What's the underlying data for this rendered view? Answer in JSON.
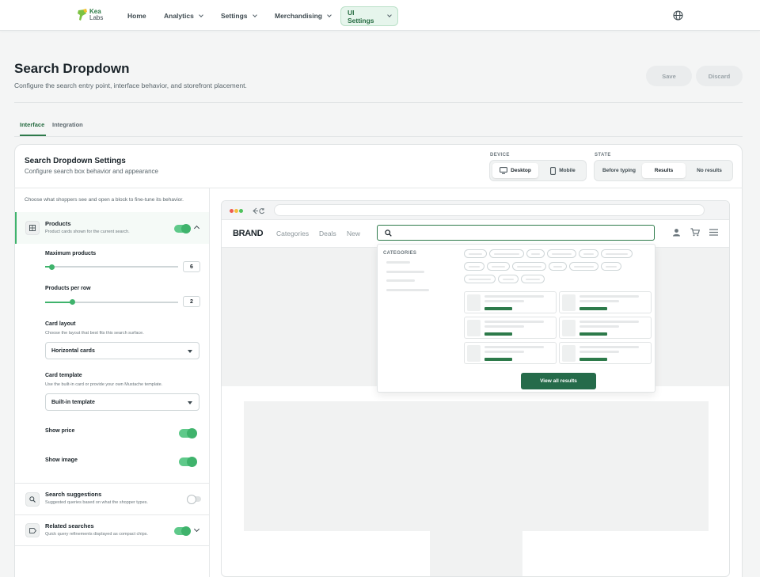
{
  "nav": {
    "logo_line1": "Kea",
    "logo_line2": "Labs",
    "items": [
      {
        "label": "Home"
      },
      {
        "label": "Analytics"
      },
      {
        "label": "Settings"
      },
      {
        "label": "Merchandising"
      },
      {
        "label": "UI Settings"
      }
    ]
  },
  "header": {
    "title": "Search Dropdown",
    "subtitle": "Configure the search entry point, interface behavior, and storefront placement.",
    "save_label": "Save",
    "discard_label": "Discard"
  },
  "tabs": [
    {
      "label": "Interface"
    },
    {
      "label": "Integration"
    }
  ],
  "settings": {
    "title": "Search Dropdown Settings",
    "subtitle": "Configure search box behavior and appearance",
    "device_label": "DEVICE",
    "device_options": [
      "Desktop",
      "Mobile"
    ],
    "device_selected": "Desktop",
    "state_label": "STATE",
    "state_options": [
      "Before typing",
      "Results",
      "No results"
    ],
    "state_selected": "Results",
    "hint": "Choose what shoppers see and open a block to fine-tune its behavior."
  },
  "blocks": {
    "products": {
      "title": "Products",
      "subtitle": "Product cards shown for the current search.",
      "enabled": true,
      "max_products_label": "Maximum products",
      "max_products_value": "6",
      "max_products_fraction": 0.05,
      "per_row_label": "Products per row",
      "per_row_value": "2",
      "per_row_fraction": 0.2,
      "card_layout_label": "Card layout",
      "card_layout_help": "Choose the layout that best fits this search surface.",
      "card_layout_value": "Horizontal cards",
      "card_template_label": "Card template",
      "card_template_help": "Use the built-in card or provide your own Mustache template.",
      "card_template_value": "Built-in template",
      "show_price_label": "Show price",
      "show_price": true,
      "show_image_label": "Show image",
      "show_image": true
    },
    "suggestions": {
      "title": "Search suggestions",
      "subtitle": "Suggested queries based on what the shopper types.",
      "enabled": false
    },
    "related": {
      "title": "Related searches",
      "subtitle": "Quick query refinements displayed as compact chips.",
      "enabled": true
    }
  },
  "preview": {
    "brand": "BRAND",
    "nav_links": [
      "Categories",
      "Deals",
      "New"
    ],
    "categories_title": "CATEGORIES",
    "view_all_label": "View all results"
  },
  "colors": {
    "accent": "#2d7a4a",
    "toggle_on": "#3fb36c",
    "active_tab_bg": "#e6f5ec"
  }
}
